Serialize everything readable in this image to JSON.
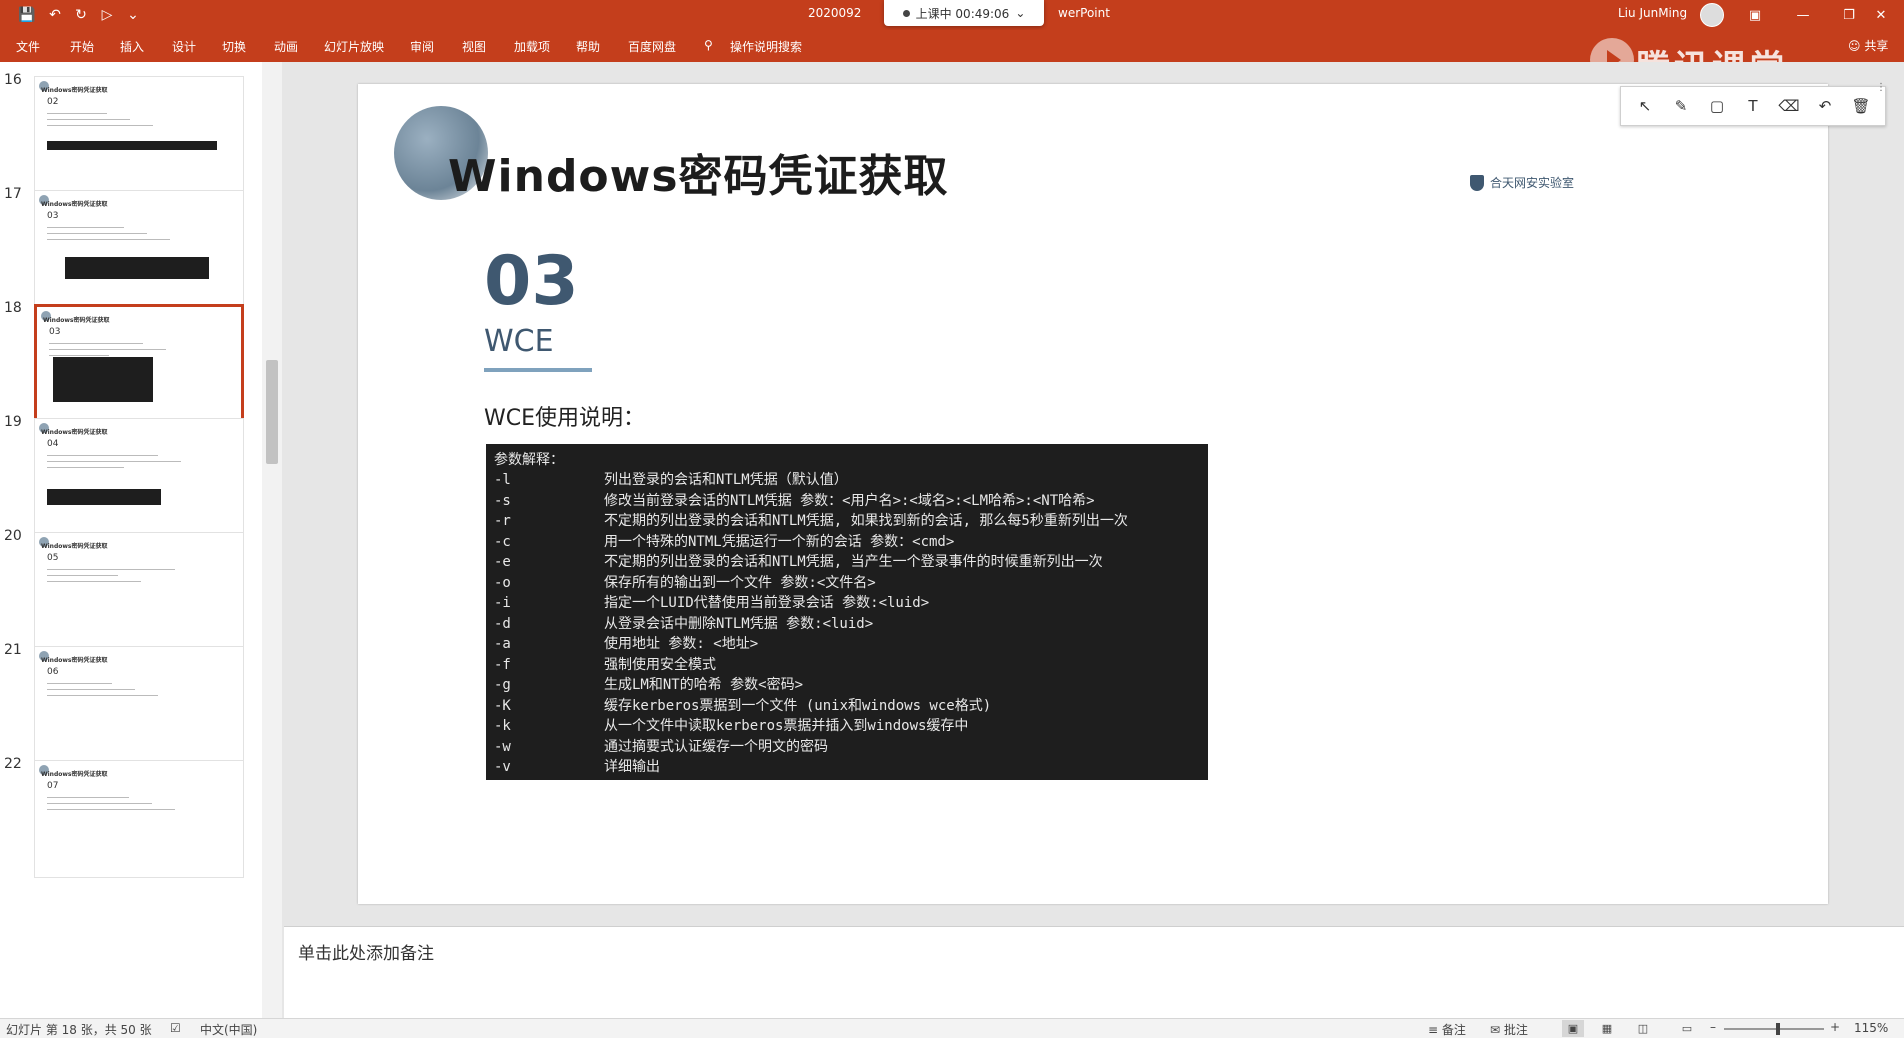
{
  "titlebar": {
    "quick_access": [
      "save-icon",
      "undo-icon",
      "redo-icon",
      "start-from-beginning-icon",
      "customize-icon"
    ],
    "doc_title": "2020092",
    "app_suffix": "werPoint",
    "class_timer": "上课中 00:49:06",
    "user_name": "Liu JunMing",
    "window_buttons": [
      "ribbon-display-icon",
      "minimize-icon",
      "restore-icon",
      "close-icon"
    ]
  },
  "ribbon": {
    "tabs": [
      "文件",
      "开始",
      "插入",
      "设计",
      "切换",
      "动画",
      "幻灯片放映",
      "审阅",
      "视图",
      "加载项",
      "帮助",
      "百度网盘"
    ],
    "tell_me": "操作说明搜索",
    "share": "共享",
    "brand_overlay": "腾讯课堂"
  },
  "thumbnails": [
    {
      "number": "16",
      "title": "Windows密码凭证获取",
      "sub": "02"
    },
    {
      "number": "17",
      "title": "Windows密码凭证获取",
      "sub": "03"
    },
    {
      "number": "18",
      "title": "Windows密码凭证获取",
      "sub": "03",
      "selected": true
    },
    {
      "number": "19",
      "title": "Windows密码凭证获取",
      "sub": "04"
    },
    {
      "number": "20",
      "title": "Windows密码凭证获取",
      "sub": "05"
    },
    {
      "number": "21",
      "title": "Windows密码凭证获取",
      "sub": "06"
    },
    {
      "number": "22",
      "title": "Windows密码凭证获取",
      "sub": "07"
    }
  ],
  "slide": {
    "title": "Windows密码凭证获取",
    "number": "03",
    "subtitle": "WCE",
    "heading": "WCE使用说明：",
    "logo_text": "合天网安实验室",
    "terminal": {
      "header": "参数解释：",
      "options": [
        {
          "flag": "-l",
          "desc": "列出登录的会话和NTLM凭据（默认值）"
        },
        {
          "flag": "-s",
          "desc": "修改当前登录会话的NTLM凭据 参数：<用户名>:<域名>:<LM哈希>:<NT哈希>"
        },
        {
          "flag": "-r",
          "desc": "不定期的列出登录的会话和NTLM凭据, 如果找到新的会话, 那么每5秒重新列出一次"
        },
        {
          "flag": "-c",
          "desc": "用一个特殊的NTML凭据运行一个新的会话 参数：<cmd>"
        },
        {
          "flag": "-e",
          "desc": "不定期的列出登录的会话和NTLM凭据, 当产生一个登录事件的时候重新列出一次"
        },
        {
          "flag": "-o",
          "desc": "保存所有的输出到一个文件 参数:<文件名>"
        },
        {
          "flag": "-i",
          "desc": "指定一个LUID代替使用当前登录会话 参数:<luid>"
        },
        {
          "flag": "-d",
          "desc": "从登录会话中删除NTLM凭据 参数:<luid>"
        },
        {
          "flag": "-a",
          "desc": "使用地址 参数: <地址>"
        },
        {
          "flag": "-f",
          "desc": "强制使用安全模式"
        },
        {
          "flag": "-g",
          "desc": "生成LM和NT的哈希 参数<密码>"
        },
        {
          "flag": "-K",
          "desc": "缓存kerberos票据到一个文件 (unix和windows wce格式)"
        },
        {
          "flag": "-k",
          "desc": "从一个文件中读取kerberos票据并插入到windows缓存中"
        },
        {
          "flag": "-w",
          "desc": "通过摘要式认证缓存一个明文的密码"
        },
        {
          "flag": "-v",
          "desc": "详细输出"
        }
      ]
    }
  },
  "annotation_tools": [
    "select-arrow-icon",
    "pen-icon",
    "rectangle-icon",
    "text-icon",
    "eraser-icon",
    "undo-icon",
    "delete-icon"
  ],
  "notes": {
    "placeholder": "单击此处添加备注"
  },
  "statusbar": {
    "slide_count": "幻灯片 第 18 张，共 50 张",
    "language": "中文(中国)",
    "notes_label": "备注",
    "comments_label": "批注",
    "zoom": "115%",
    "zoom_fraction": 0.54
  }
}
